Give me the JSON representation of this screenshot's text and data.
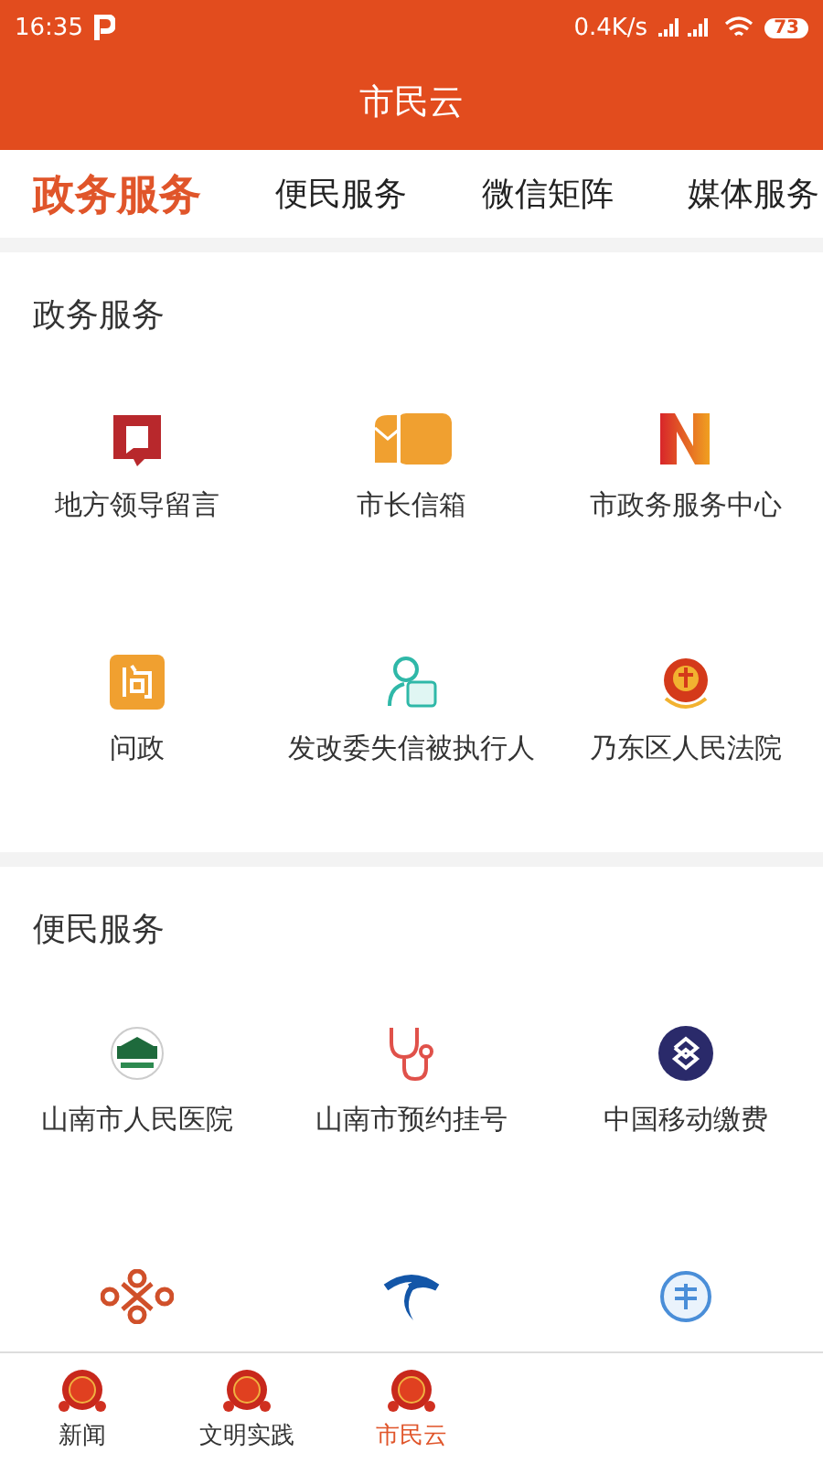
{
  "status_bar": {
    "time": "16:35",
    "speed": "0.4K/s",
    "battery": "73"
  },
  "window": {
    "title": "市民云"
  },
  "tabs": [
    {
      "label": "政务服务",
      "selected": true
    },
    {
      "label": "便民服务",
      "selected": false
    },
    {
      "label": "微信矩阵",
      "selected": false
    },
    {
      "label": "媒体服务",
      "selected": false
    }
  ],
  "sections": [
    {
      "title": "政务服务",
      "items": [
        {
          "label": "地方领导留言"
        },
        {
          "label": "市长信箱"
        },
        {
          "label": "市政务服务中心"
        },
        {
          "label": "问政"
        },
        {
          "label": "发改委失信被执行人"
        },
        {
          "label": "乃东区人民法院"
        }
      ]
    },
    {
      "title": "便民服务",
      "items": [
        {
          "kind": "labeled",
          "label": "山南市人民医院"
        },
        {
          "kind": "labeled",
          "label": "山南市预约挂号"
        },
        {
          "kind": "labeled",
          "label": "中国移动缴费"
        },
        {
          "kind": "icon"
        },
        {
          "kind": "icon"
        },
        {
          "kind": "icon"
        }
      ]
    }
  ],
  "bottom_nav": [
    {
      "label": "新闻",
      "selected": false
    },
    {
      "label": "文明实践",
      "selected": false
    },
    {
      "label": "市民云",
      "selected": true
    }
  ]
}
